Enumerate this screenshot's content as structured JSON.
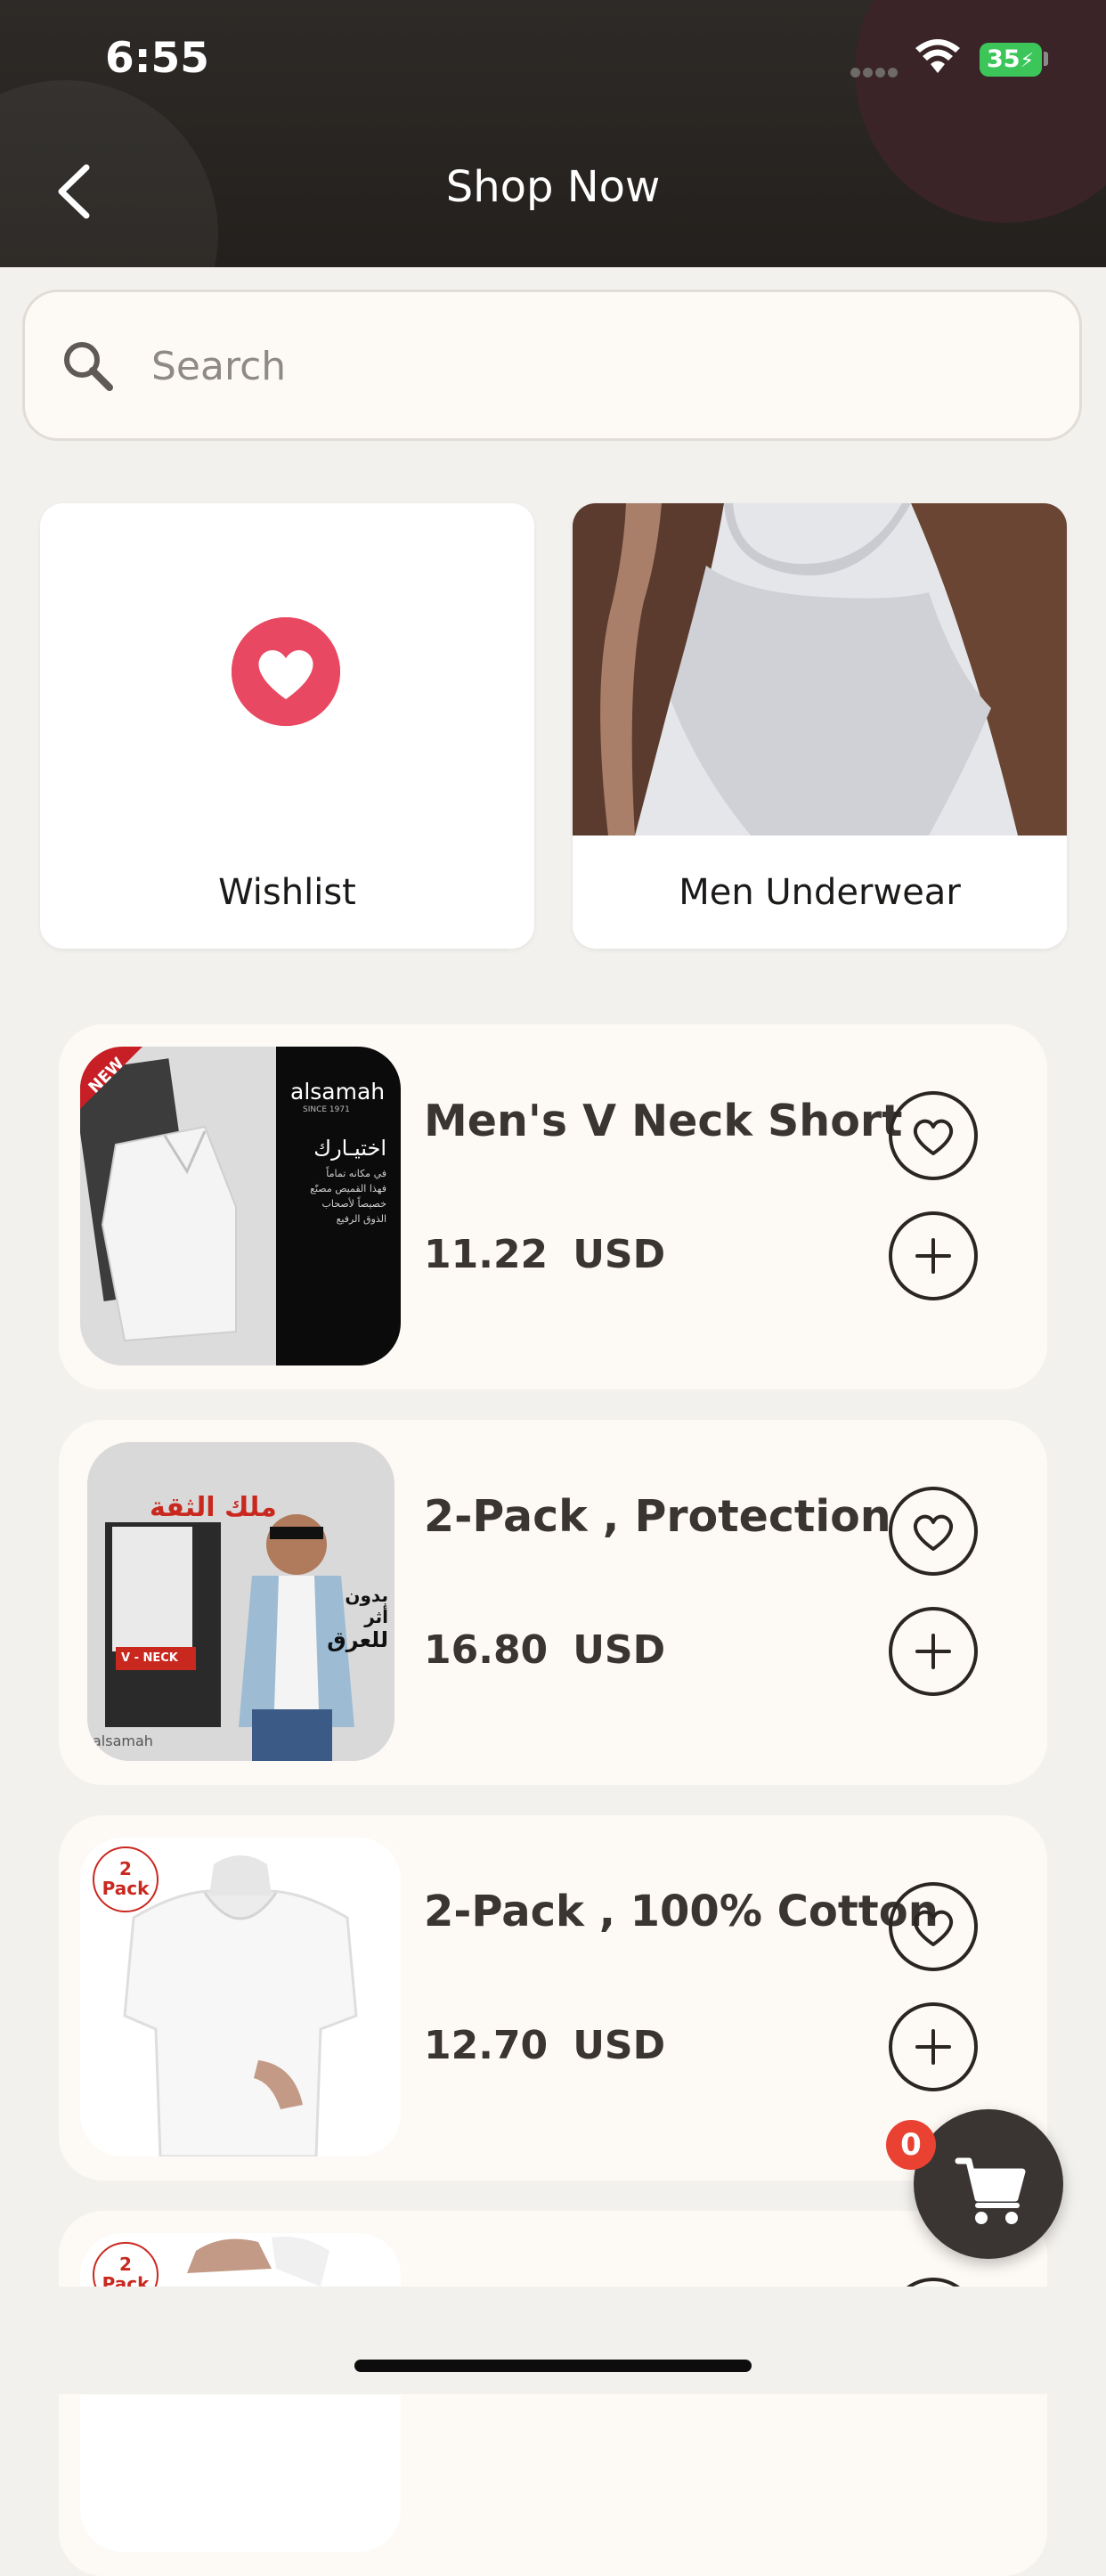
{
  "status_bar": {
    "time": "6:55",
    "battery": "35"
  },
  "header": {
    "title": "Shop Now"
  },
  "search": {
    "placeholder": "Search"
  },
  "tiles": [
    {
      "label": "Wishlist"
    },
    {
      "label": "Men Underwear"
    }
  ],
  "products": [
    {
      "name": "Men's V Neck Short",
      "price": "11.22",
      "currency": "USD"
    },
    {
      "name": "2-Pack , Protection",
      "price": "16.80",
      "currency": "USD"
    },
    {
      "name": "2-Pack , 100% Cotton",
      "price": "12.70",
      "currency": "USD"
    }
  ],
  "product_images": {
    "p1": {
      "badge": "NEW",
      "brand": "alsamah",
      "since": "SINCE 1971",
      "quote_title": "اختيـارك",
      "quote_lines": [
        "في مكانه تماماً",
        "فهذا القميص مصنّع",
        "خصيصاً لأصحاب",
        "الذوق الرفيع"
      ]
    },
    "p2": {
      "headline": "ملك الثقة",
      "side_text": [
        "بدون",
        "أثر",
        "للعرق"
      ],
      "box_label": "V - NECK",
      "brand": "alsamah"
    },
    "p3": {
      "pack_top": "2",
      "pack_bottom": "Pack"
    },
    "p4": {
      "pack_top": "2",
      "pack_bottom": "Pack"
    }
  },
  "cart": {
    "count": "0"
  },
  "colors": {
    "header_bg": "#2a2623",
    "accent_heart": "#e94862",
    "badge_red": "#e94233",
    "card_bg": "#fdfaf6",
    "page_bg": "#f3f1ee"
  }
}
